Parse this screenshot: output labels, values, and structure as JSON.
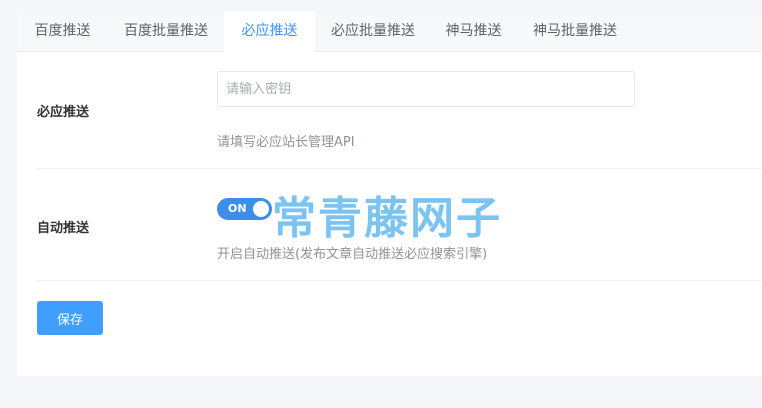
{
  "tabs": [
    {
      "label": "百度推送"
    },
    {
      "label": "百度批量推送"
    },
    {
      "label": "必应推送"
    },
    {
      "label": "必应批量推送"
    },
    {
      "label": "神马推送"
    },
    {
      "label": "神马批量推送"
    }
  ],
  "active_tab": 2,
  "form": {
    "bing_push": {
      "label": "必应推送",
      "input_placeholder": "请输入密钥",
      "input_value": "",
      "hint": "请填写必应站长管理API"
    },
    "auto_push": {
      "label": "自动推送",
      "switch_text": "ON",
      "hint": "开启自动推送(发布文章自动推送必应搜索引擎)"
    },
    "save_label": "保存"
  },
  "watermark": "常青藤网子",
  "colors": {
    "accent": "#409eff",
    "active_tab_text": "#3b96f5",
    "switch_on": "#3c8ee8"
  }
}
